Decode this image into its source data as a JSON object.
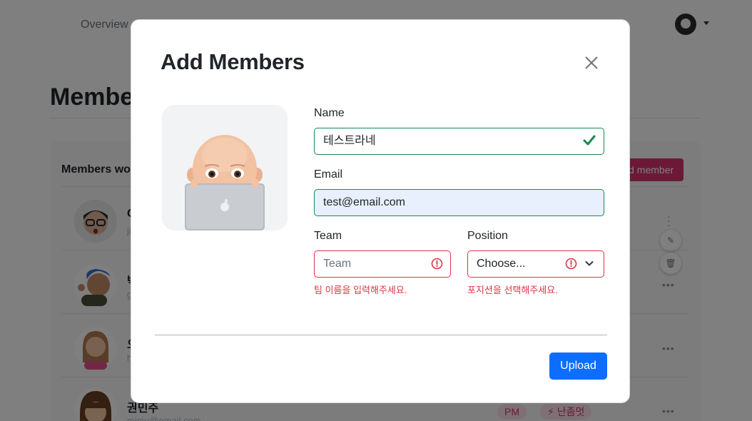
{
  "background": {
    "nav": {
      "overview_label": "Overview"
    },
    "page_title": "Members",
    "card": {
      "title": "Members working",
      "add_button_label": "Add member"
    },
    "members": [
      {
        "name": "C",
        "email": "ji"
      },
      {
        "name": "박",
        "email": "g"
      },
      {
        "name": "오",
        "email": "h"
      },
      {
        "name": "권민주",
        "email": "minju@email.com",
        "position": "PM",
        "tag": "⚡ 난좀멋"
      }
    ]
  },
  "modal": {
    "title": "Add Members",
    "form": {
      "name": {
        "label": "Name",
        "value": "테스트라네"
      },
      "email": {
        "label": "Email",
        "value": "test@email.com"
      },
      "team": {
        "label": "Team",
        "placeholder": "Team",
        "error": "팀 이름을 입력해주세요."
      },
      "position": {
        "label": "Position",
        "selected": "Choose...",
        "error": "포지션을 선택해주세요."
      }
    },
    "upload_label": "Upload"
  },
  "colors": {
    "valid": "#198754",
    "invalid": "#dc3545",
    "primary": "#0d6efd",
    "accent": "#d6336c",
    "autofill": "#e8f0fe"
  },
  "icons": {
    "close": "close-icon",
    "valid": "check-icon",
    "invalid": "exclamation-circle-icon",
    "select": "chevron-down-icon"
  }
}
